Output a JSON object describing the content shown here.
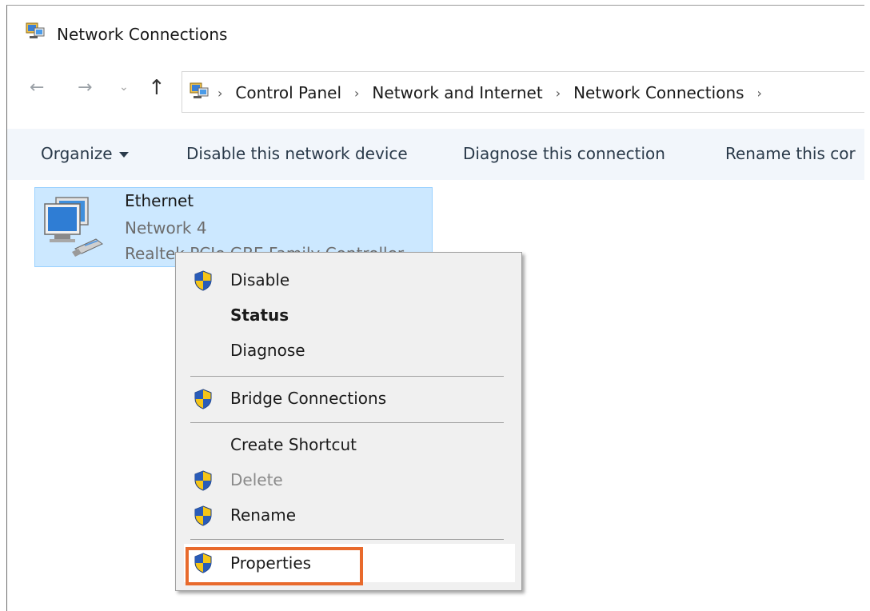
{
  "window": {
    "title": "Network Connections",
    "title_icon": "network-connections-icon"
  },
  "nav": {
    "back_icon": "arrow-left-icon",
    "forward_icon": "arrow-right-icon",
    "recent_icon": "chevron-down-icon",
    "up_icon": "arrow-up-icon"
  },
  "address": {
    "breadcrumbs": [
      "Control Panel",
      "Network and Internet",
      "Network Connections"
    ]
  },
  "toolbar": {
    "organize": "Organize",
    "disable": "Disable this network device",
    "diagnose": "Diagnose this connection",
    "rename": "Rename this cor"
  },
  "connection": {
    "name": "Ethernet",
    "network": "Network 4",
    "device": "Realtek PCIe GBE Family Controller"
  },
  "context_menu": {
    "items": [
      {
        "label": "Disable",
        "icon": "uac-shield-icon"
      },
      {
        "label": "Status",
        "icon": ""
      },
      {
        "label": "Diagnose",
        "icon": ""
      },
      {
        "label": "Bridge Connections",
        "icon": "uac-shield-icon"
      },
      {
        "label": "Create Shortcut",
        "icon": ""
      },
      {
        "label": "Delete",
        "icon": "uac-shield-icon",
        "disabled": true
      },
      {
        "label": "Rename",
        "icon": "uac-shield-icon"
      },
      {
        "label": "Properties",
        "icon": "uac-shield-icon",
        "highlighted": true
      }
    ]
  },
  "colors": {
    "selection": "#cce8ff",
    "command_bar": "#f2f6fb",
    "menu_bg": "#f0f0f0",
    "highlight_box": "#e86a2c"
  }
}
